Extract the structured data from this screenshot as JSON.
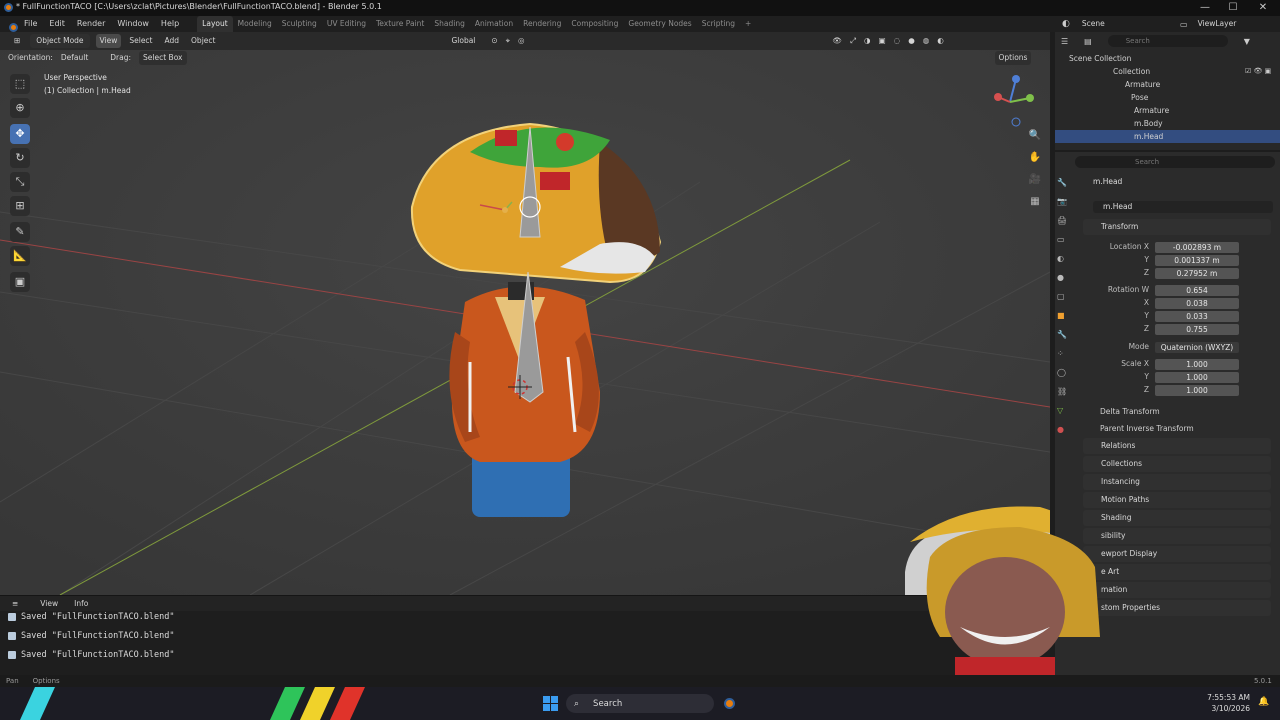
{
  "title_bar": {
    "title": "* FullFunctionTACO [C:\\Users\\zclat\\Pictures\\Blender\\FullFunctionTACO.blend] - Blender 5.0.1",
    "minimize": "—",
    "maximize": "☐",
    "close": "✕"
  },
  "menu": {
    "items": [
      "File",
      "Edit",
      "Render",
      "Window",
      "Help"
    ]
  },
  "workspaces": [
    "Layout",
    "Modeling",
    "Sculpting",
    "UV Editing",
    "Texture Paint",
    "Shading",
    "Animation",
    "Rendering",
    "Compositing",
    "Geometry Nodes",
    "Scripting",
    "+"
  ],
  "scene": {
    "label": "Scene",
    "view_layer": "ViewLayer"
  },
  "viewport_header": {
    "mode": "Object Mode",
    "menus": [
      "View",
      "Select",
      "Add",
      "Object"
    ],
    "transform_orientation": "Global",
    "options": "Options"
  },
  "tool_header": {
    "orientation_label": "Orientation:",
    "orientation_value": "Default",
    "drag_label": "Drag:",
    "drag_value": "Select Box"
  },
  "viewport_overlay": {
    "perspective": "User Perspective",
    "collection_info": "(1) Collection | m.Head"
  },
  "info_editor": {
    "header_menus": [
      "View",
      "Info"
    ],
    "log_lines": [
      "Saved \"FullFunctionTACO.blend\"",
      "Saved \"FullFunctionTACO.blend\"",
      "Saved \"FullFunctionTACO.blend\""
    ]
  },
  "outliner": {
    "search_placeholder": "Search",
    "rows": [
      {
        "label": "Scene Collection",
        "indent": 1,
        "selected": false
      },
      {
        "label": "Collection",
        "indent": 2,
        "selected": false
      },
      {
        "label": "Armature",
        "indent": 3,
        "selected": false
      },
      {
        "label": "Pose",
        "indent": 4,
        "selected": false
      },
      {
        "label": "Armature",
        "indent": 4,
        "selected": false
      },
      {
        "label": "m.Body",
        "indent": 4,
        "selected": false
      },
      {
        "label": "m.Head",
        "indent": 4,
        "selected": true
      }
    ]
  },
  "properties": {
    "search_placeholder": "Search",
    "object_name": "m.Head",
    "object_datablock": "m.Head",
    "transform_label": "Transform",
    "location": {
      "label": "Location X",
      "x": "-0.002893 m",
      "y": "0.001337 m",
      "z": "0.27952 m"
    },
    "rotation": {
      "label": "Rotation W",
      "w": "0.654",
      "x": "0.038",
      "y": "0.033",
      "z": "0.755"
    },
    "mode": {
      "label": "Mode",
      "value": "Quaternion (WXYZ)"
    },
    "scale": {
      "label": "Scale X",
      "x": "1.000",
      "y": "1.000",
      "z": "1.000"
    },
    "axis_labels": {
      "x": "X",
      "y": "Y",
      "z": "Z"
    },
    "subpanels": [
      "Delta Transform",
      "Parent Inverse Transform"
    ],
    "panels": [
      "Relations",
      "Collections",
      "Instancing",
      "Motion Paths",
      "Shading",
      "sibility",
      "ewport Display",
      "e Art",
      "mation",
      "stom Properties"
    ]
  },
  "status_bar": {
    "left": [
      "Pan",
      "Options"
    ],
    "version": "5.0.1"
  },
  "taskbar": {
    "search_placeholder": "Search",
    "time": "7:55:53 AM",
    "date": "3/10/2026"
  },
  "colors": {
    "selection": "#4772b3",
    "outliner_selected": "#334d80",
    "x_axis": "#c94a4a",
    "y_axis": "#8ab04a",
    "taco_shell": "#e0a12a",
    "hoodie": "#c9571d",
    "jeans": "#2f6fb3"
  }
}
